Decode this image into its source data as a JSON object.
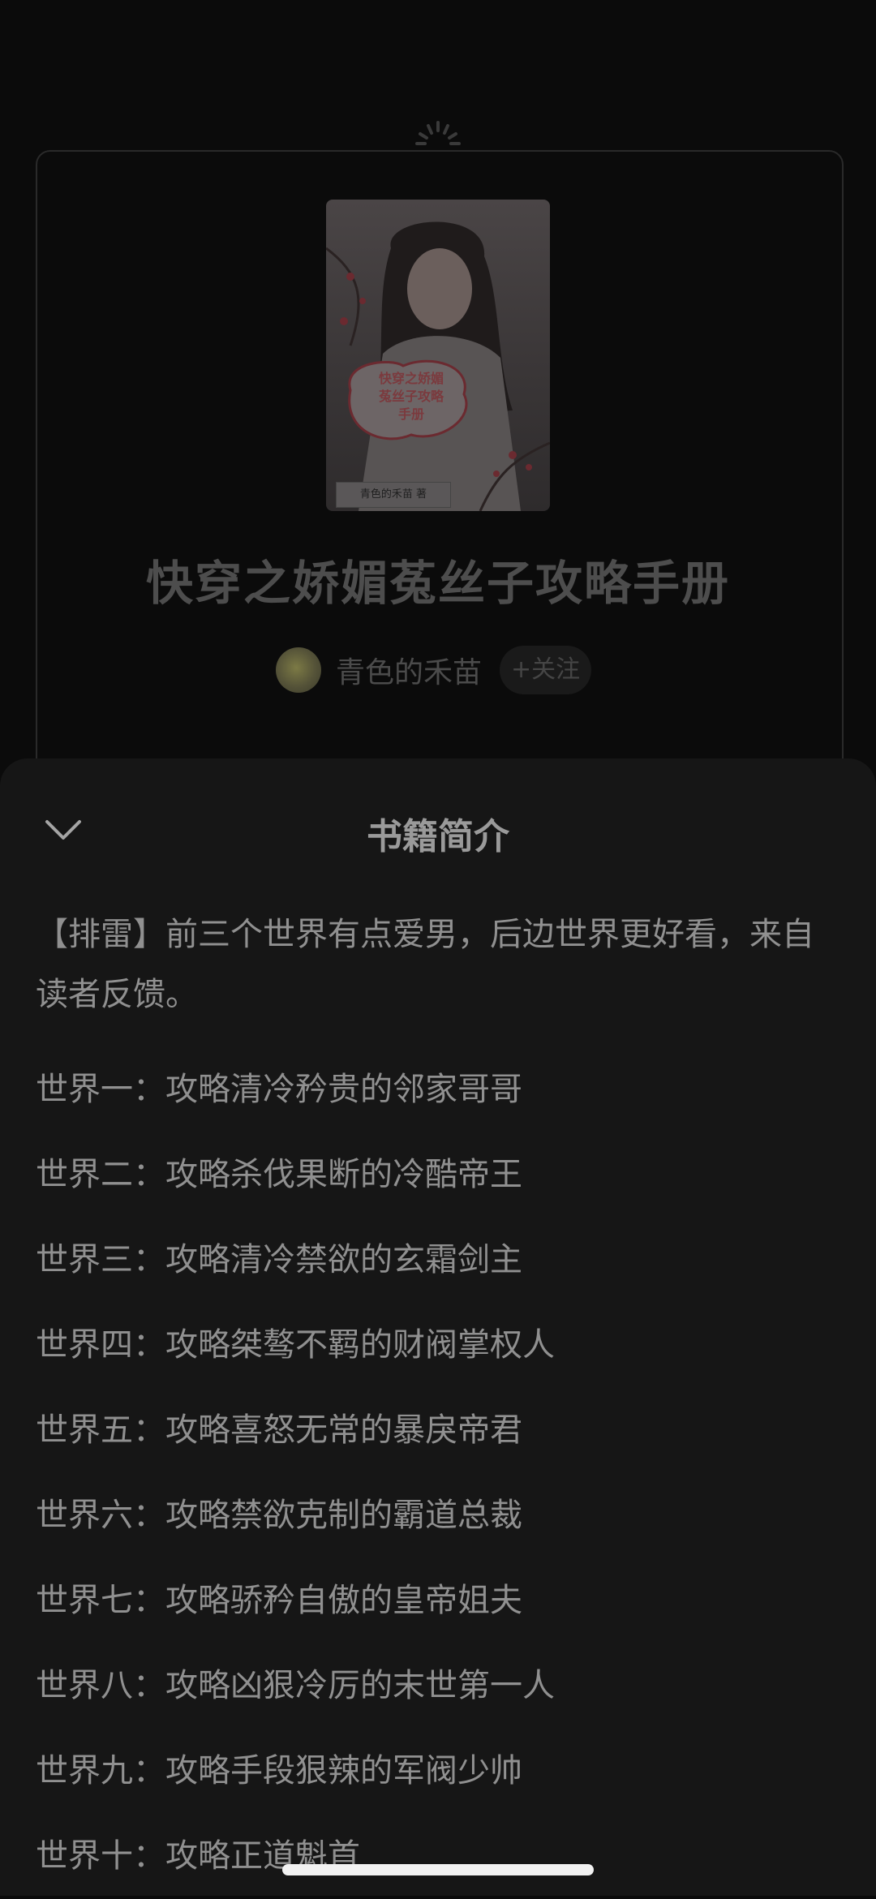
{
  "book": {
    "cover_title": "快穿之娇媚\n菟丝子攻略\n手册",
    "cover_author": "青色的禾苗 著",
    "title": "快穿之娇媚菟丝子攻略手册",
    "author": "青色的禾苗",
    "follow_label": "+关注"
  },
  "sheet": {
    "title": "书籍简介",
    "intro": "【排雷】前三个世界有点爱男，后边世界更好看，来自读者反馈。",
    "worlds": [
      "世界一：攻略清冷矜贵的邻家哥哥",
      "世界二：攻略杀伐果断的冷酷帝王",
      "世界三：攻略清冷禁欲的玄霜剑主",
      "世界四：攻略桀骜不羁的财阀掌权人",
      "世界五：攻略喜怒无常的暴戾帝君",
      "世界六：攻略禁欲克制的霸道总裁",
      "世界七：攻略骄矜自傲的皇帝姐夫",
      "世界八：攻略凶狠冷厉的末世第一人",
      "世界九：攻略手段狠辣的军阀少帅",
      "世界十：攻略正道魁首"
    ]
  },
  "icons": {
    "collapse": "chevron-down-icon",
    "ornament": "loading-spinner-icon"
  }
}
